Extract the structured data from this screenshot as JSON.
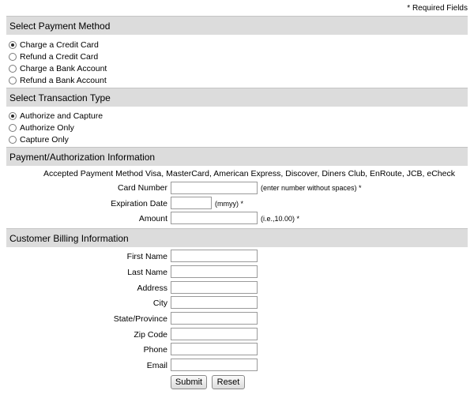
{
  "required_note": "* Required Fields",
  "payment_method": {
    "header": "Select Payment Method",
    "options": [
      {
        "label": "Charge a Credit Card",
        "checked": true
      },
      {
        "label": "Refund a Credit Card",
        "checked": false
      },
      {
        "label": "Charge a Bank Account",
        "checked": false
      },
      {
        "label": "Refund a Bank Account",
        "checked": false
      }
    ]
  },
  "transaction_type": {
    "header": "Select Transaction Type",
    "options": [
      {
        "label": "Authorize and Capture",
        "checked": true
      },
      {
        "label": "Authorize Only",
        "checked": false
      },
      {
        "label": "Capture Only",
        "checked": false
      }
    ]
  },
  "payment_info": {
    "header": "Payment/Authorization Information",
    "accepted_label": "Accepted Payment Method",
    "accepted_methods": "Visa, MasterCard, American Express, Discover, Diners Club, EnRoute, JCB, eCheck",
    "card_number": {
      "label": "Card Number",
      "value": "",
      "hint": "(enter number without spaces) *"
    },
    "expiration": {
      "label": "Expiration Date",
      "value": "",
      "hint": "(mmyy) *"
    },
    "amount": {
      "label": "Amount",
      "value": "",
      "hint": "(i.e.,10.00) *"
    }
  },
  "billing": {
    "header": "Customer Billing Information",
    "fields": [
      {
        "label": "First Name",
        "value": ""
      },
      {
        "label": "Last Name",
        "value": ""
      },
      {
        "label": "Address",
        "value": ""
      },
      {
        "label": "City",
        "value": ""
      },
      {
        "label": "State/Province",
        "value": ""
      },
      {
        "label": "Zip Code",
        "value": ""
      },
      {
        "label": "Phone",
        "value": ""
      },
      {
        "label": "Email",
        "value": ""
      }
    ]
  },
  "buttons": {
    "submit": "Submit",
    "reset": "Reset"
  }
}
